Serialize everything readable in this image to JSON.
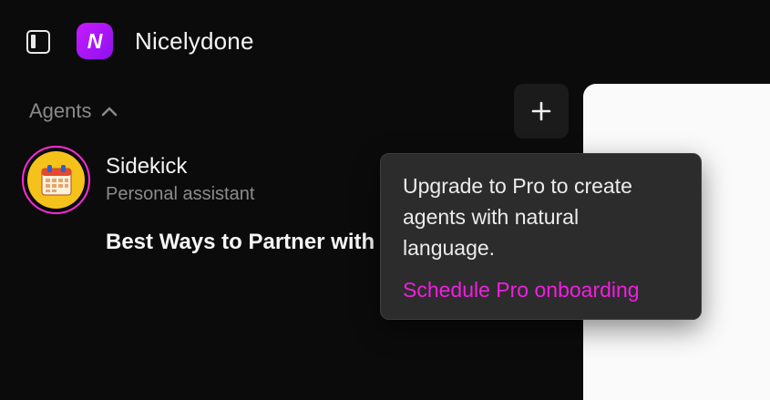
{
  "app": {
    "name": "Nicelydone",
    "logo_letter": "N",
    "brand_color": "#b81aff"
  },
  "sidebar": {
    "section_title": "Agents",
    "add_button_icon": "plus-icon",
    "agents": [
      {
        "name": "Sidekick",
        "subtitle": "Personal assistant",
        "avatar_icon": "calendar-icon"
      }
    ],
    "chats": [
      {
        "title": "Best Ways to Partner with"
      }
    ]
  },
  "tooltip": {
    "text": "Upgrade to Pro to create agents with natural language.",
    "link_label": "Schedule Pro onboarding",
    "link_color": "#f21ee0"
  }
}
